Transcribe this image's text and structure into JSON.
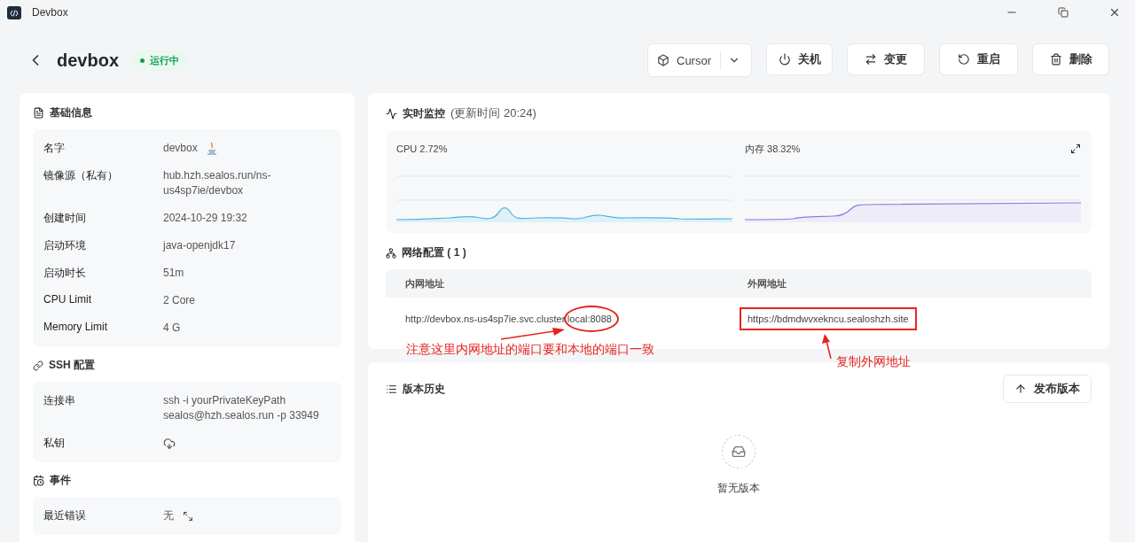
{
  "window": {
    "title": "Devbox"
  },
  "header": {
    "name": "devbox",
    "status": "运行中"
  },
  "actions": [
    {
      "kind": "ide",
      "label": "Cursor"
    },
    {
      "kind": "power",
      "label": "关机"
    },
    {
      "kind": "swap",
      "label": "变更"
    },
    {
      "kind": "restart",
      "label": "重启"
    },
    {
      "kind": "delete",
      "label": "删除"
    }
  ],
  "basic_info": {
    "title": "基础信息",
    "rows": [
      {
        "kind": "name",
        "label": "名字",
        "value": "devbox"
      },
      {
        "kind": "text",
        "label": "镜像源（私有）",
        "value": "hub.hzh.sealos.run/ns-us4sp7ie/devbox"
      },
      {
        "kind": "text",
        "label": "创建时间",
        "value": "2024-10-29 19:32"
      },
      {
        "kind": "text",
        "label": "启动环境",
        "value": "java-openjdk17"
      },
      {
        "kind": "text",
        "label": "启动时长",
        "value": "51m"
      },
      {
        "kind": "text",
        "label": "CPU Limit",
        "value": "2 Core"
      },
      {
        "kind": "text",
        "label": "Memory Limit",
        "value": "4 G"
      }
    ]
  },
  "ssh": {
    "title": "SSH 配置",
    "rows": [
      {
        "kind": "text",
        "label": "连接串",
        "value": "ssh -i yourPrivateKeyPath sealos@hzh.sealos.run -p 33949"
      },
      {
        "kind": "download",
        "label": "私钥"
      }
    ]
  },
  "events": {
    "title": "事件",
    "rows": [
      {
        "kind": "expand",
        "label": "最近错误",
        "value": "无"
      }
    ]
  },
  "monitor": {
    "title": "实时监控",
    "updated": "(更新时间  20:24)",
    "charts": [
      {
        "kind": "cpu",
        "label": "CPU 2.72%"
      },
      {
        "kind": "memory",
        "label": "内存 38.32%"
      }
    ]
  },
  "network": {
    "title": "网络配置 ( 1 )",
    "columns": [
      "内网地址",
      "外网地址"
    ],
    "rows": [
      [
        "http://devbox.ns-us4sp7ie.svc.cluster.local:8088",
        "https://bdmdwvxekncu.sealoshzh.site"
      ]
    ]
  },
  "annotations": [
    {
      "text": "注意这里内网地址的端口要和本地的端口一致"
    },
    {
      "text": "复制外网地址"
    }
  ],
  "versions": {
    "title": "版本历史",
    "button": "发布版本",
    "empty": "暂无版本"
  }
}
